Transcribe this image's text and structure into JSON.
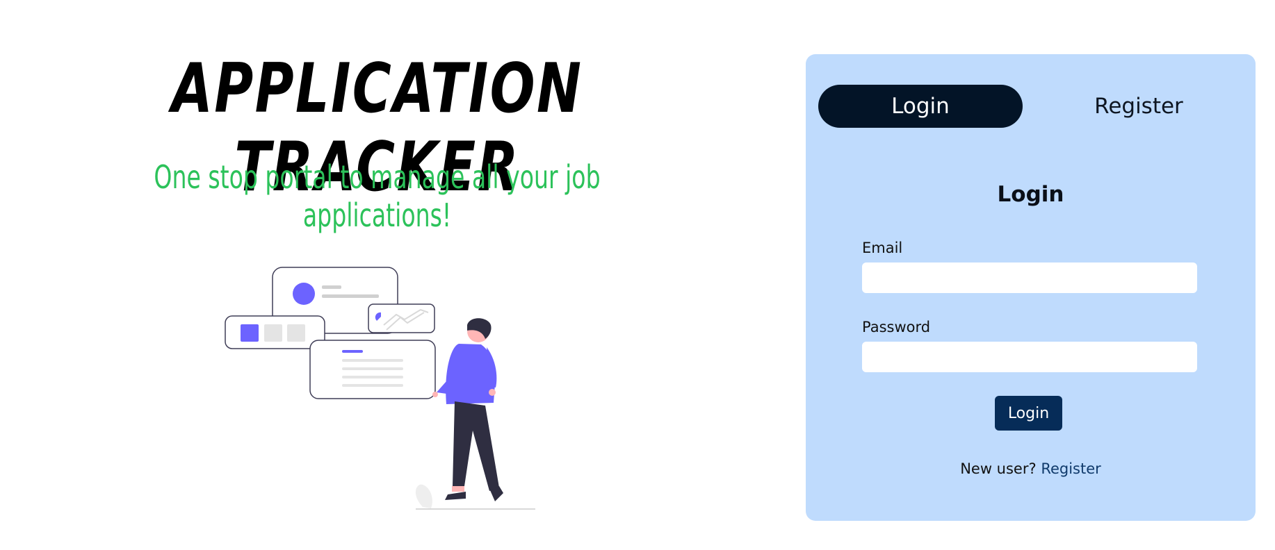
{
  "hero": {
    "title": "APPLICATION TRACKER",
    "tagline": "One stop portal to manage all your job applications!"
  },
  "auth": {
    "tabs": [
      {
        "label": "Login",
        "active": true
      },
      {
        "label": "Register",
        "active": false
      }
    ],
    "form_title": "Login",
    "email": {
      "label": "Email",
      "value": "",
      "placeholder": ""
    },
    "password": {
      "label": "Password",
      "value": "",
      "placeholder": ""
    },
    "submit_label": "Login",
    "register_prompt": "New user?",
    "register_link": "Register"
  },
  "colors": {
    "tagline": "#2cc25a",
    "card_background": "#bfdbfd",
    "active_tab": "#031427",
    "login_button": "#062c58",
    "illustration_accent": "#6c63ff"
  }
}
